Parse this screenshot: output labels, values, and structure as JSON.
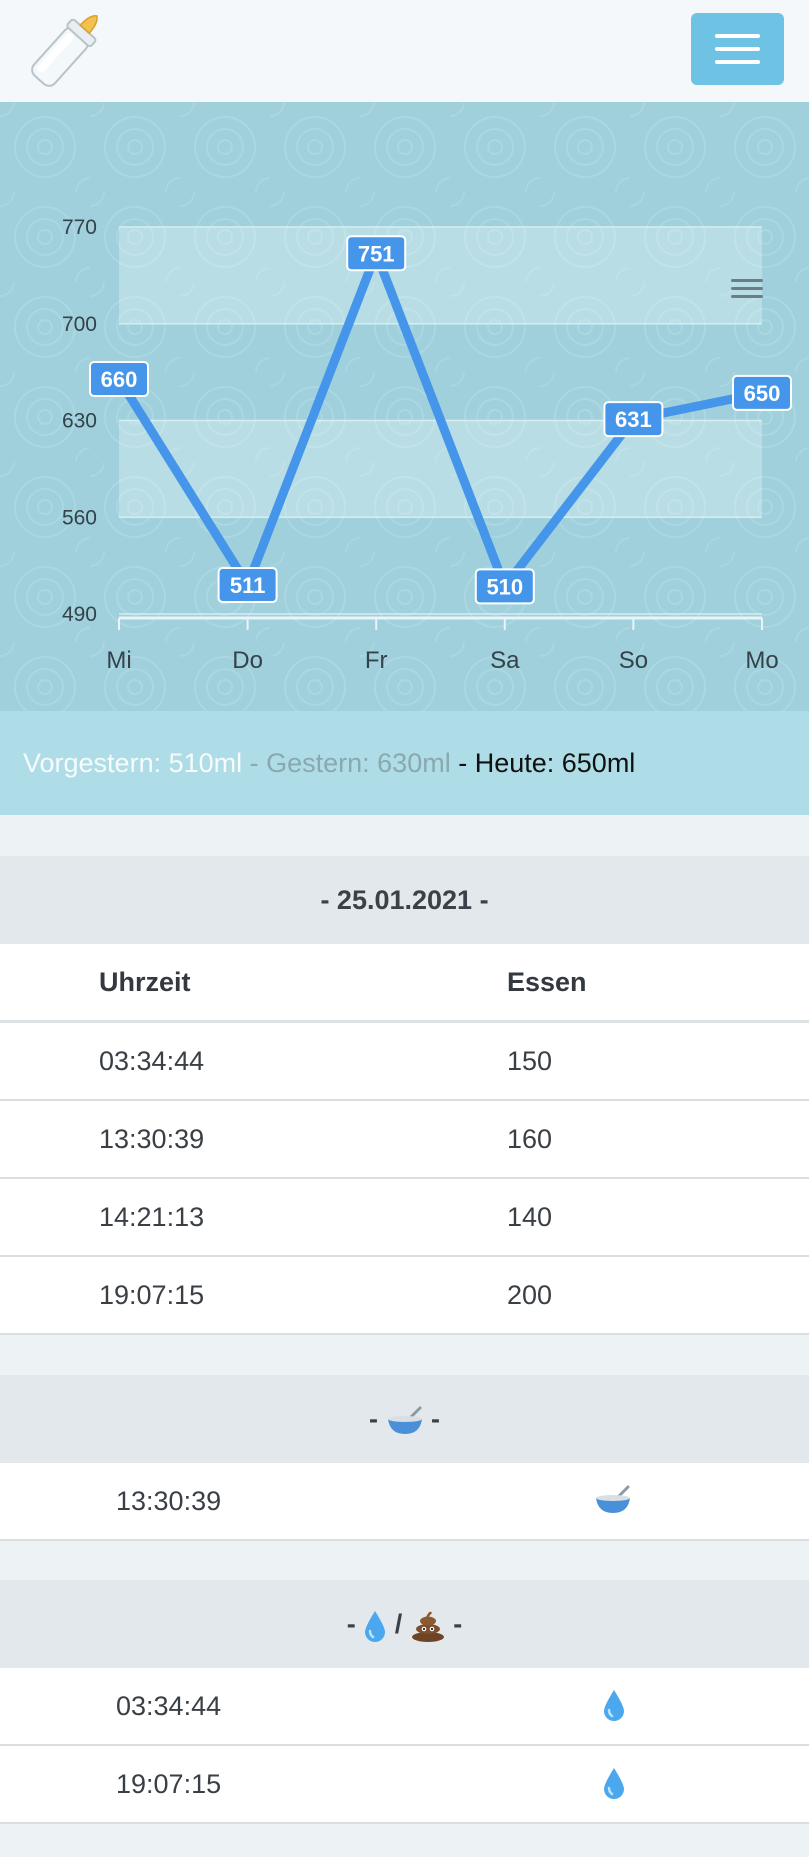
{
  "header": {
    "logo_icon": "baby-bottle-icon",
    "menu_icon": "hamburger-icon"
  },
  "chart_data": {
    "type": "line",
    "categories": [
      "Mi",
      "Do",
      "Fr",
      "Sa",
      "So",
      "Mo"
    ],
    "series": [
      {
        "values": [
          660,
          511,
          751,
          510,
          631,
          650
        ]
      }
    ],
    "y_ticks": [
      490,
      560,
      630,
      700,
      770
    ],
    "ylim": [
      490,
      770
    ],
    "title": "",
    "xlabel": "",
    "ylabel": "",
    "line_color": "#4596ea",
    "band_color": "#ffffff"
  },
  "summary": {
    "day_before": "Vorgestern: 510ml",
    "sep1": " - ",
    "yesterday": "Gestern: 630ml",
    "sep2": " - ",
    "today": "Heute: 650ml"
  },
  "sections": {
    "date_title": "- 25.01.2021 -",
    "col_time": "Uhrzeit",
    "col_food": "Essen",
    "feed_rows": [
      {
        "time": "03:34:44",
        "amount": "150"
      },
      {
        "time": "13:30:39",
        "amount": "160"
      },
      {
        "time": "14:21:13",
        "amount": "140"
      },
      {
        "time": "19:07:15",
        "amount": "200"
      }
    ],
    "bowl_title_left": "-",
    "bowl_title_right": "-",
    "bowl_rows": [
      {
        "time": "13:30:39",
        "icon": "bowl-icon"
      }
    ],
    "diaper_title_left": "-",
    "diaper_title_mid": "/",
    "diaper_title_right": "-",
    "diaper_rows": [
      {
        "time": "03:34:44",
        "icon": "droplet-icon"
      },
      {
        "time": "19:07:15",
        "icon": "droplet-icon"
      }
    ]
  }
}
